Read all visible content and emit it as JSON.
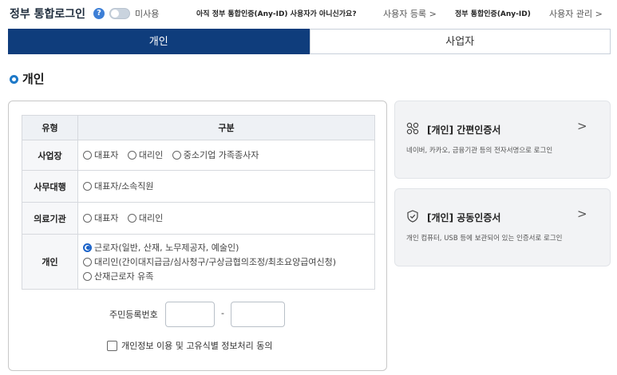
{
  "header": {
    "title": "정부 통합로그인",
    "help_glyph": "?",
    "toggle_label": "미사용",
    "anyid_question": "아직 정부 통합인증(Any-ID) 사용자가 아니신가요?",
    "register_link": "사용자 등록 >",
    "anyid_label": "정부 통합인증(Any-ID)",
    "manage_link": "사용자 관리 >"
  },
  "tabs": [
    {
      "label": "개인",
      "active": true
    },
    {
      "label": "사업자",
      "active": false
    }
  ],
  "section_title": "개인",
  "table": {
    "headers": [
      "유형",
      "구분"
    ],
    "rows": [
      {
        "type": "사업장",
        "options": [
          "대표자",
          "대리인",
          "중소기업 가족종사자"
        ]
      },
      {
        "type": "사무대행",
        "options": [
          "대표자/소속직원"
        ]
      },
      {
        "type": "의료기관",
        "options": [
          "대표자",
          "대리인"
        ]
      },
      {
        "type": "개인",
        "options": [
          "근로자(일반, 산재, 노무제공자, 예술인)",
          "대리인(간이대지급금/심사청구/구상금협의조정/최초요양급여신청)",
          "산재근로자 유족"
        ],
        "selected": 0
      }
    ]
  },
  "rrn": {
    "label": "주민등록번호",
    "separator": "-"
  },
  "consent_label": "개인정보 이용 및 고유식별 정보처리 동의",
  "cards": [
    {
      "title": "[개인] 간편인증서",
      "description": "네이버, 카카오, 금융기관 등의 전자서명으로 로그인",
      "chevron": ">",
      "icon": "link-icon"
    },
    {
      "title": "[개인] 공동인증서",
      "description": "개인 컴퓨터, USB 등에 보관되어 있는 인증서로 로그인",
      "chevron": ">",
      "icon": "shield-check-icon"
    }
  ],
  "colors": {
    "primary": "#0f3d7c",
    "accent": "#1e79c8",
    "card_bg": "#f2f3f5"
  }
}
